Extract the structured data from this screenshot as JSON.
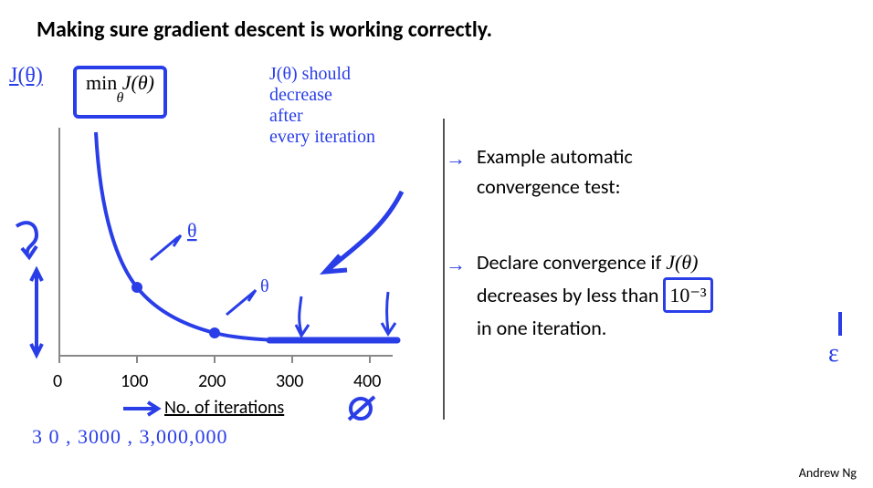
{
  "title": "Making sure gradient descent is working correctly.",
  "credit": "Andrew Ng",
  "min_expr": {
    "top": "min",
    "arg": "J(θ)",
    "sub": "θ"
  },
  "y_axis_ann": "J(θ)",
  "x_axis_label": "No. of iterations",
  "ticks": {
    "t0": "0",
    "t1": "100",
    "t2": "200",
    "t3": "300",
    "t4": "400"
  },
  "note_decrease_l1": "J(θ) should",
  "note_decrease_l2": "decrease",
  "note_decrease_l3": "after",
  "note_decrease_l4": "every  iteration",
  "note_scale": "3 0 ,     3000 ,   3,000,000",
  "right": {
    "arrow": "→",
    "example_l1": "Example automatic",
    "example_l2": "convergence test:",
    "declare_l1a": "Declare convergence if ",
    "declare_l1b": "J(θ)",
    "declare_l2a": "decreases by less than ",
    "declare_eps": "10⁻³",
    "declare_l3": "in one iteration.",
    "epsilon_sym": "ε"
  },
  "chart_data": {
    "type": "line",
    "title": "Cost J(θ) vs. iterations",
    "xlabel": "No. of iterations",
    "ylabel": "J(θ)",
    "x": [
      0,
      50,
      100,
      150,
      200,
      250,
      300,
      350,
      400
    ],
    "y_rel": [
      1.0,
      0.45,
      0.25,
      0.16,
      0.11,
      0.085,
      0.075,
      0.07,
      0.07
    ],
    "xlim": [
      0,
      400
    ],
    "ylim_rel": [
      0,
      1
    ],
    "markers_x": [
      100,
      200
    ],
    "note": "y values are relative (initial cost = 1); the slide does not show a numeric y-axis"
  }
}
